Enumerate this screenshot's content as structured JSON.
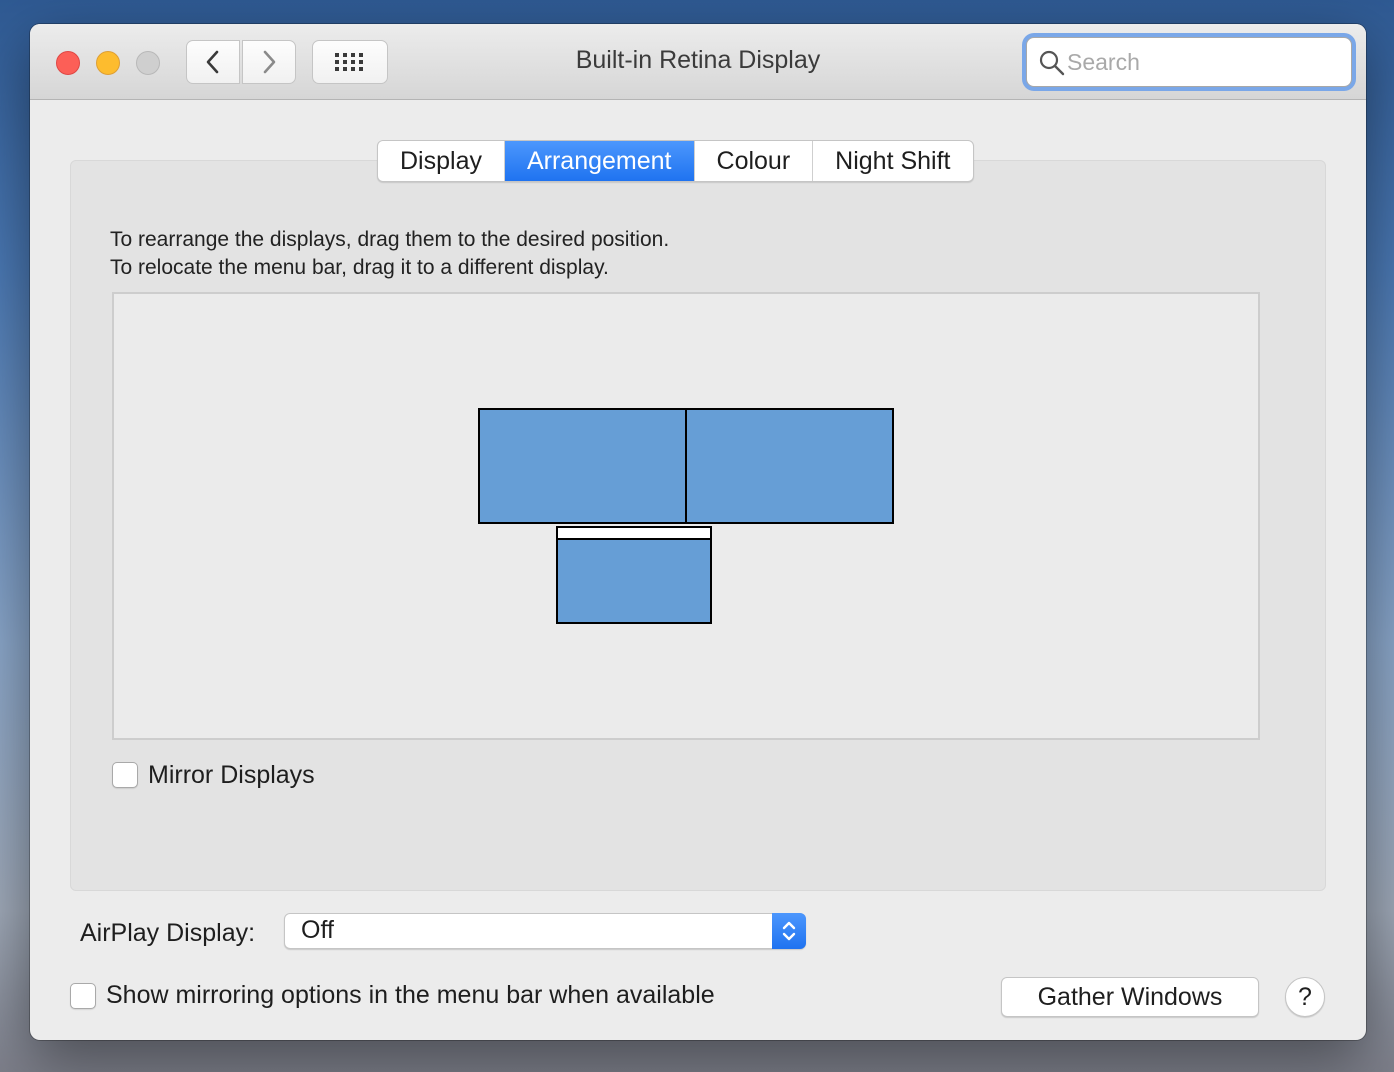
{
  "window": {
    "title": "Built-in Retina Display"
  },
  "toolbar": {
    "back_icon": "chevron-left-icon",
    "forward_icon": "chevron-right-icon",
    "show_all_icon": "grid-icon"
  },
  "search": {
    "placeholder": "Search",
    "value": ""
  },
  "tabs": [
    {
      "label": "Display",
      "active": false
    },
    {
      "label": "Arrangement",
      "active": true
    },
    {
      "label": "Colour",
      "active": false
    },
    {
      "label": "Night Shift",
      "active": false
    }
  ],
  "arrangement": {
    "instruction_line1": "To rearrange the displays, drag them to the desired position.",
    "instruction_line2": "To relocate the menu bar, drag it to a different display.",
    "display_color": "#669ed6"
  },
  "mirror_displays": {
    "label": "Mirror Displays",
    "checked": false
  },
  "airplay": {
    "label": "AirPlay Display:",
    "value": "Off"
  },
  "show_mirroring": {
    "label": "Show mirroring options in the menu bar when available",
    "checked": false
  },
  "gather_windows": {
    "label": "Gather Windows"
  },
  "help": {
    "label": "?"
  },
  "colors": {
    "accent": "#1f73f0",
    "close": "#fc5f57",
    "minimize": "#fdbc2e",
    "zoom_disabled": "#cfcfcf"
  }
}
